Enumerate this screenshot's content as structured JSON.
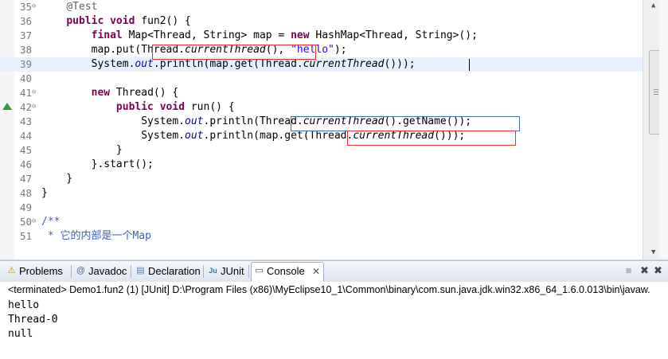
{
  "editor": {
    "lines": [
      {
        "num": "35",
        "fold": "⊖",
        "segments": [
          {
            "t": "    ",
            "c": ""
          },
          {
            "t": "@Test",
            "c": "an"
          }
        ]
      },
      {
        "num": "36",
        "fold": "",
        "segments": [
          {
            "t": "    ",
            "c": ""
          },
          {
            "t": "public",
            "c": "kw"
          },
          {
            "t": " ",
            "c": ""
          },
          {
            "t": "void",
            "c": "kw"
          },
          {
            "t": " fun2() {",
            "c": ""
          }
        ]
      },
      {
        "num": "37",
        "fold": "",
        "segments": [
          {
            "t": "        ",
            "c": ""
          },
          {
            "t": "final",
            "c": "kw"
          },
          {
            "t": " Map<Thread, String> map = ",
            "c": ""
          },
          {
            "t": "new",
            "c": "kw"
          },
          {
            "t": " HashMap<Thread, String>();",
            "c": ""
          }
        ]
      },
      {
        "num": "38",
        "fold": "",
        "segments": [
          {
            "t": "        map.put(Thread.",
            "c": ""
          },
          {
            "t": "currentThread",
            "c": "it"
          },
          {
            "t": "(), ",
            "c": ""
          },
          {
            "t": "\"hello\"",
            "c": "st"
          },
          {
            "t": ");",
            "c": ""
          }
        ]
      },
      {
        "num": "39",
        "fold": "",
        "segments": [
          {
            "t": "        System.",
            "c": ""
          },
          {
            "t": "out",
            "c": "fi"
          },
          {
            "t": ".println(map.get(Thread.",
            "c": ""
          },
          {
            "t": "currentThread",
            "c": "it"
          },
          {
            "t": "()));",
            "c": ""
          }
        ]
      },
      {
        "num": "40",
        "fold": "",
        "segments": [
          {
            "t": "",
            "c": ""
          }
        ]
      },
      {
        "num": "41",
        "fold": "⊖",
        "segments": [
          {
            "t": "        ",
            "c": ""
          },
          {
            "t": "new",
            "c": "kw"
          },
          {
            "t": " Thread() {",
            "c": ""
          }
        ]
      },
      {
        "num": "42",
        "fold": "⊖",
        "segments": [
          {
            "t": "            ",
            "c": ""
          },
          {
            "t": "public",
            "c": "kw"
          },
          {
            "t": " ",
            "c": ""
          },
          {
            "t": "void",
            "c": "kw"
          },
          {
            "t": " run() {",
            "c": ""
          }
        ]
      },
      {
        "num": "43",
        "fold": "",
        "segments": [
          {
            "t": "                System.",
            "c": ""
          },
          {
            "t": "out",
            "c": "fi"
          },
          {
            "t": ".println(Thread.",
            "c": ""
          },
          {
            "t": "currentThread",
            "c": "it"
          },
          {
            "t": "().getName());",
            "c": ""
          }
        ]
      },
      {
        "num": "44",
        "fold": "",
        "segments": [
          {
            "t": "                System.",
            "c": ""
          },
          {
            "t": "out",
            "c": "fi"
          },
          {
            "t": ".println(map.get(Thread.",
            "c": ""
          },
          {
            "t": "currentThread",
            "c": "it"
          },
          {
            "t": "()));",
            "c": ""
          }
        ]
      },
      {
        "num": "45",
        "fold": "",
        "segments": [
          {
            "t": "            }",
            "c": ""
          }
        ]
      },
      {
        "num": "46",
        "fold": "",
        "segments": [
          {
            "t": "        }.start();",
            "c": ""
          }
        ]
      },
      {
        "num": "47",
        "fold": "",
        "segments": [
          {
            "t": "    }",
            "c": ""
          }
        ]
      },
      {
        "num": "48",
        "fold": "",
        "segments": [
          {
            "t": "}",
            "c": ""
          }
        ]
      },
      {
        "num": "49",
        "fold": "",
        "segments": [
          {
            "t": "",
            "c": ""
          }
        ]
      },
      {
        "num": "50",
        "fold": "⊖",
        "segments": [
          {
            "t": "/**",
            "c": "cm"
          }
        ]
      },
      {
        "num": "51",
        "fold": "",
        "segments": [
          {
            "t": " * 它的内部是一个Map",
            "c": "cm"
          }
        ]
      }
    ]
  },
  "tabs": [
    {
      "name": "problems",
      "icon": "⚠",
      "icon_name": "problems-icon",
      "label": "Problems",
      "active": false
    },
    {
      "name": "javadoc",
      "icon": "@",
      "icon_name": "javadoc-icon",
      "label": "Javadoc",
      "active": false
    },
    {
      "name": "declaration",
      "icon": "▤",
      "icon_name": "declaration-icon",
      "label": "Declaration",
      "active": false
    },
    {
      "name": "junit",
      "icon": "Ju",
      "icon_name": "junit-icon",
      "label": "JUnit",
      "active": false
    },
    {
      "name": "console",
      "icon": "▭",
      "icon_name": "console-icon",
      "label": "Console",
      "active": true
    }
  ],
  "console": {
    "close_glyph": "✕",
    "header": "<terminated> Demo1.fun2 (1) [JUnit] D:\\Program Files (x86)\\MyEclipse10_1\\Common\\binary\\com.sun.java.jdk.win32.x86_64_1.6.0.013\\bin\\javaw.",
    "output": [
      "hello",
      "Thread-0",
      "null"
    ]
  },
  "toolbar": {
    "terminate_glyph": "■",
    "remove_glyph": "✖",
    "remove_all_glyph": "✖"
  }
}
